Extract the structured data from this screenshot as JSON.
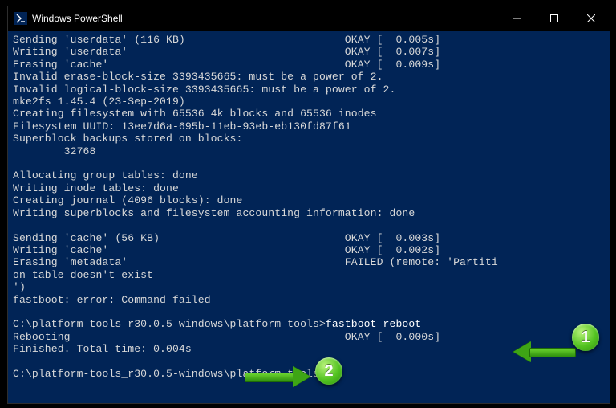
{
  "window": {
    "title": "Windows PowerShell"
  },
  "term": {
    "l01": "Sending 'userdata' (116 KB)                         OKAY [  0.005s]",
    "l02": "Writing 'userdata'                                  OKAY [  0.007s]",
    "l03": "Erasing 'cache'                                     OKAY [  0.009s]",
    "l04": "Invalid erase-block-size 3393435665: must be a power of 2.",
    "l05": "Invalid logical-block-size 3393435665: must be a power of 2.",
    "l06": "mke2fs 1.45.4 (23-Sep-2019)",
    "l07": "Creating filesystem with 65536 4k blocks and 65536 inodes",
    "l08": "Filesystem UUID: 13ee7d6a-695b-11eb-93eb-eb130fd87f61",
    "l09": "Superblock backups stored on blocks:",
    "l10": "        32768",
    "l11": "",
    "l12": "Allocating group tables: done",
    "l13": "Writing inode tables: done",
    "l14": "Creating journal (4096 blocks): done",
    "l15": "Writing superblocks and filesystem accounting information: done",
    "l16": "",
    "l17": "Sending 'cache' (56 KB)                             OKAY [  0.003s]",
    "l18": "Writing 'cache'                                     OKAY [  0.002s]",
    "l19": "Erasing 'metadata'                                  FAILED (remote: 'Partiti",
    "l20": "on table doesn't exist",
    "l21": "')",
    "l22": "fastboot: error: Command failed",
    "l23": "",
    "l24p": "C:\\platform-tools_r30.0.5-windows\\platform-tools>",
    "l24c": "fastboot reboot",
    "l25": "Rebooting                                           OKAY [  0.000s]",
    "l26": "Finished. Total time: 0.004s",
    "l27": "",
    "l28p": "C:\\platform-tools_r30.0.5-windows\\platform-tools>",
    "l28c": ""
  },
  "annotations": {
    "badge1": "1",
    "badge2": "2"
  }
}
